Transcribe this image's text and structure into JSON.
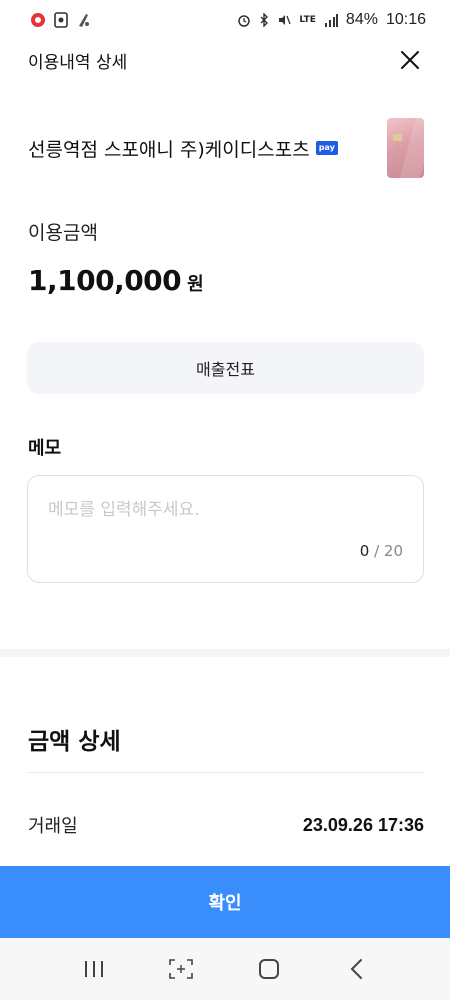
{
  "status_bar": {
    "battery": "84%",
    "time": "10:16",
    "network": "LTE"
  },
  "header": {
    "title": "이용내역 상세"
  },
  "merchant": {
    "name": "선릉역점 스포애니 주)케이디스포츠",
    "pay_badge": "pay"
  },
  "amount": {
    "label": "이용금액",
    "value": "1,100,000",
    "unit": "원"
  },
  "receipt_button": {
    "label": "매출전표"
  },
  "memo": {
    "heading": "메모",
    "placeholder": "메모를 입력해주세요.",
    "value": "",
    "count_current": "0",
    "count_separator": " / ",
    "count_max": "20"
  },
  "details": {
    "heading": "금액 상세",
    "rows": [
      {
        "label": "거래일",
        "value": "23.09.26 17:36"
      }
    ]
  },
  "confirm_button": {
    "label": "확인"
  },
  "colors": {
    "primary": "#3a8efc",
    "receipt_bg": "#f3f5f9",
    "pay_badge": "#1f5be6"
  }
}
